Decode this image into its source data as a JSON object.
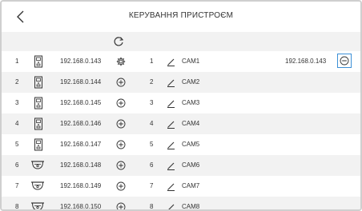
{
  "header": {
    "title": "КЕРУВАННЯ ПРИСТРОЄМ",
    "back_icon": "chevron-left-icon"
  },
  "toolbar": {
    "refresh_icon": "refresh-icon"
  },
  "devices": [
    {
      "index": "1",
      "type": "intercom",
      "ip": "192.168.0.143",
      "action_icon": "gear-icon"
    },
    {
      "index": "2",
      "type": "intercom",
      "ip": "192.168.0.144",
      "action_icon": "add-icon"
    },
    {
      "index": "3",
      "type": "intercom",
      "ip": "192.168.0.145",
      "action_icon": "add-icon"
    },
    {
      "index": "4",
      "type": "intercom",
      "ip": "192.168.0.146",
      "action_icon": "add-icon"
    },
    {
      "index": "5",
      "type": "intercom",
      "ip": "192.168.0.147",
      "action_icon": "add-icon"
    },
    {
      "index": "6",
      "type": "camera",
      "ip": "192.168.0.148",
      "action_icon": "add-icon"
    },
    {
      "index": "7",
      "type": "camera",
      "ip": "192.168.0.149",
      "action_icon": "add-icon"
    },
    {
      "index": "8",
      "type": "camera",
      "ip": "192.168.0.150",
      "action_icon": "add-icon"
    }
  ],
  "channels": [
    {
      "index": "1",
      "name": "CAM1",
      "ip": "192.168.0.143",
      "remove_icon": "remove-icon"
    },
    {
      "index": "2",
      "name": "CAM2",
      "ip": ""
    },
    {
      "index": "3",
      "name": "CAM3",
      "ip": ""
    },
    {
      "index": "4",
      "name": "CAM4",
      "ip": ""
    },
    {
      "index": "5",
      "name": "CAM5",
      "ip": ""
    },
    {
      "index": "6",
      "name": "CAM6",
      "ip": ""
    },
    {
      "index": "7",
      "name": "CAM7",
      "ip": ""
    },
    {
      "index": "8",
      "name": "CAM8",
      "ip": ""
    }
  ],
  "colors": {
    "accent": "#3b8fd6",
    "stripe": "#f2f2f2",
    "text": "#333333"
  }
}
